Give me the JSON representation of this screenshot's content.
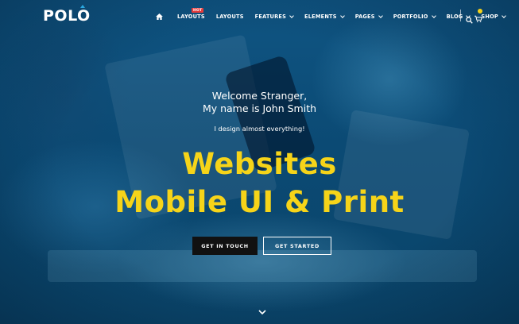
{
  "brand": {
    "logo_text": "POLO",
    "accent_color": "#2aa7e0"
  },
  "navbar": {
    "home_icon": "home-icon",
    "items": [
      {
        "label": "LAYOUTS",
        "badge": "HOT",
        "has_dropdown": false
      },
      {
        "label": "LAYOUTS",
        "has_dropdown": false
      },
      {
        "label": "FEATURES",
        "has_dropdown": true
      },
      {
        "label": "ELEMENTS",
        "has_dropdown": true
      },
      {
        "label": "PAGES",
        "has_dropdown": true
      },
      {
        "label": "PORTFOLIO",
        "has_dropdown": true
      },
      {
        "label": "BLOG",
        "has_dropdown": true
      },
      {
        "label": "SHOP",
        "has_dropdown": true
      }
    ],
    "search_icon": "search-icon",
    "cart_icon": "cart-icon",
    "cart_badge_color": "#f5d21a",
    "hot_badge_color": "#e63b3b"
  },
  "hero": {
    "welcome_line1": "Welcome Stranger,",
    "welcome_line2": "My name is John Smith",
    "tagline": "I design almost everything!",
    "headline_line1": "Websites",
    "headline_line2": "Mobile UI & Print",
    "headline_color": "#f6d419",
    "overlay_color": "#0d4e78",
    "buttons": {
      "primary_label": "GET IN TOUCH",
      "secondary_label": "GET STARTED"
    },
    "scroll_icon": "chevron-down-icon"
  }
}
